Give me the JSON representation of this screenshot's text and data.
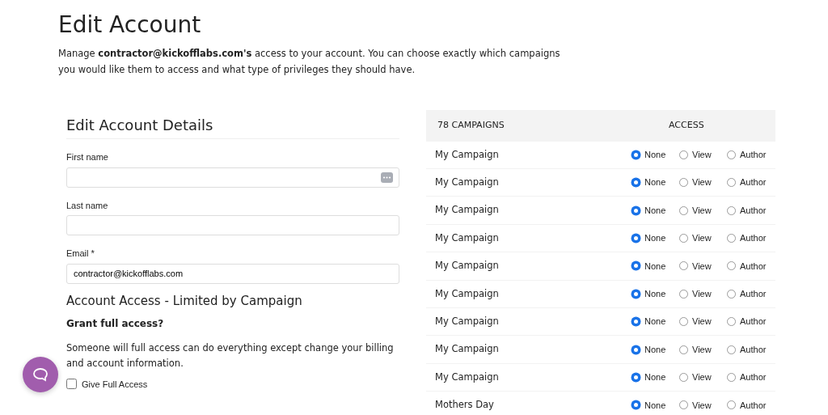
{
  "title": "Edit Account",
  "intro": "Manage **contractor@kickofflabs.com's** access to your account. You can choose exactly which campaigns you would like them to access and what type of privileges they should have.",
  "details": {
    "heading": "Edit Account Details",
    "fields": [
      {
        "label": "First name",
        "kind": "autofill"
      },
      {
        "label": "Last name",
        "kind": "text"
      },
      {
        "label": "Email *",
        "value": "contractor@kickofflabs.com",
        "kind": "text"
      }
    ]
  },
  "access": {
    "heading": "Account Access - Limited by Campaign",
    "question": "Grant full access?",
    "description": "Someone will full access can do everything except change your billing and account information.",
    "checkbox": {
      "label": "Give Full Access",
      "checked": false
    }
  },
  "campaigns": {
    "columns": [
      "78 CAMPAIGNS",
      "ACCESS"
    ],
    "rows": [
      {
        "name": "My Campaign",
        "options": [
          {
            "label": "None",
            "selected": true
          },
          {
            "label": "View",
            "selected": false
          },
          {
            "label": "Author",
            "selected": false
          }
        ]
      },
      {
        "name": "My Campaign",
        "options": [
          {
            "label": "None",
            "selected": true
          },
          {
            "label": "View",
            "selected": false
          },
          {
            "label": "Author",
            "selected": false
          }
        ]
      },
      {
        "name": "My Campaign",
        "options": [
          {
            "label": "None",
            "selected": true
          },
          {
            "label": "View",
            "selected": false
          },
          {
            "label": "Author",
            "selected": false
          }
        ]
      },
      {
        "name": "My Campaign",
        "options": [
          {
            "label": "None",
            "selected": true
          },
          {
            "label": "View",
            "selected": false
          },
          {
            "label": "Author",
            "selected": false
          }
        ]
      },
      {
        "name": "My Campaign",
        "options": [
          {
            "label": "None",
            "selected": true
          },
          {
            "label": "View",
            "selected": false
          },
          {
            "label": "Author",
            "selected": false
          }
        ]
      },
      {
        "name": "My Campaign",
        "options": [
          {
            "label": "None",
            "selected": true
          },
          {
            "label": "View",
            "selected": false
          },
          {
            "label": "Author",
            "selected": false
          }
        ]
      },
      {
        "name": "My Campaign",
        "options": [
          {
            "label": "None",
            "selected": true
          },
          {
            "label": "View",
            "selected": false
          },
          {
            "label": "Author",
            "selected": false
          }
        ]
      },
      {
        "name": "My Campaign",
        "options": [
          {
            "label": "None",
            "selected": true
          },
          {
            "label": "View",
            "selected": false
          },
          {
            "label": "Author",
            "selected": false
          }
        ]
      },
      {
        "name": "My Campaign",
        "options": [
          {
            "label": "None",
            "selected": true
          },
          {
            "label": "View",
            "selected": false
          },
          {
            "label": "Author",
            "selected": false
          }
        ]
      },
      {
        "name": "Mothers Day",
        "options": [
          {
            "label": "None",
            "selected": true
          },
          {
            "label": "View",
            "selected": false
          },
          {
            "label": "Author",
            "selected": false
          }
        ]
      }
    ]
  }
}
